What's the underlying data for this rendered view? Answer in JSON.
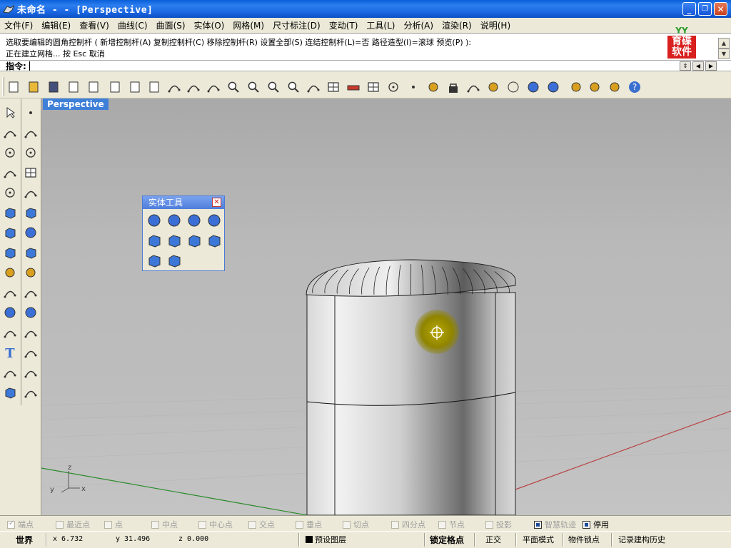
{
  "window": {
    "title": "未命名 -  - [Perspective]",
    "minimize": "_",
    "restore": "❐",
    "close": "✕"
  },
  "menu": [
    "文件(F)",
    "编辑(E)",
    "查看(V)",
    "曲线(C)",
    "曲面(S)",
    "实体(O)",
    "网格(M)",
    "尺寸标注(D)",
    "变动(T)",
    "工具(L)",
    "分析(A)",
    "渲染(R)",
    "说明(H)"
  ],
  "command": {
    "history_line1": "选取要编辑的圆角控制杆 ( 新增控制杆(A)  复制控制杆(C)  移除控制杆(R)  设置全部(S)  连结控制杆(L)=否  路径造型(I)=滚球  预览(P) ):",
    "history_line2": "正在建立网格... 按 Esc 取消",
    "prompt_label": "指令:",
    "prompt_value": ""
  },
  "logo": {
    "top": "YY",
    "line1": "育碟",
    "line2": "软件",
    "color": "#d8201e"
  },
  "toolbar_icons": [
    "new-file-icon",
    "open-folder-icon",
    "save-icon",
    "print-icon",
    "import-icon",
    "cut-icon",
    "copy-icon",
    "paste-icon",
    "undo-icon",
    "pan-hand-icon",
    "rotate-view-icon",
    "zoom-icon",
    "zoom-window-icon",
    "zoom-extents-icon",
    "zoom-selected-icon",
    "undo-view-icon",
    "four-viewports-icon",
    "car-icon",
    "grid-plane-icon",
    "osnap-icon",
    "point-object-icon",
    "light-bulb-icon",
    "lock-icon",
    "layer-icon",
    "color-wheel-icon",
    "wireframe-sphere-icon",
    "shaded-sphere-icon",
    "render-sphere-icon",
    "flag-icon",
    "gear-icon",
    "options-icon",
    "help-icon"
  ],
  "left_tools": [
    "select-arrow-icon",
    "point-icon",
    "polyline-icon",
    "curve-icon",
    "circle-icon",
    "ellipse-icon",
    "arc-icon",
    "rectangle-icon",
    "polygon-icon",
    "freeform-curve-icon",
    "surface-icon",
    "patch-icon",
    "box-icon",
    "sphere-icon",
    "cylinder-icon",
    "mesh-icon",
    "explode-icon",
    "lightning-icon",
    "trim-icon",
    "split-icon",
    "boolean-union-icon",
    "boolean-split-icon",
    "fillet-icon",
    "extend-icon",
    "text-icon",
    "scale-icon",
    "array-icon",
    "dimension-icon",
    "solid-tools-icon",
    "ruler-icon"
  ],
  "viewport": {
    "title": "Perspective",
    "axes": {
      "x": "x",
      "y": "y",
      "z": "z"
    }
  },
  "solid_panel": {
    "title": "实体工具",
    "close": "✕",
    "icons": [
      "boolean-union-icon",
      "boolean-difference-icon",
      "boolean-intersection-icon",
      "boolean-split-icon",
      "cap-holes-icon",
      "extract-surface-icon",
      "extrude-face-icon",
      "move-face-icon",
      "solid-box-icon",
      "solid-edit-icon"
    ]
  },
  "osnaps": [
    {
      "label": "端点",
      "checked": true,
      "enabled": false
    },
    {
      "label": "最近点",
      "checked": false,
      "enabled": false
    },
    {
      "label": "点",
      "checked": false,
      "enabled": false
    },
    {
      "label": "中点",
      "checked": false,
      "enabled": false
    },
    {
      "label": "中心点",
      "checked": false,
      "enabled": false
    },
    {
      "label": "交点",
      "checked": false,
      "enabled": false
    },
    {
      "label": "垂点",
      "checked": false,
      "enabled": false
    },
    {
      "label": "切点",
      "checked": false,
      "enabled": false
    },
    {
      "label": "四分点",
      "checked": false,
      "enabled": false
    },
    {
      "label": "节点",
      "checked": false,
      "enabled": false
    },
    {
      "label": "投影",
      "checked": false,
      "enabled": false
    },
    {
      "label": "智慧轨迹",
      "checked": true,
      "enabled": false
    },
    {
      "label": "停用",
      "checked": true,
      "enabled": true
    }
  ],
  "status": {
    "cplane": "世界",
    "x": "x 6.732",
    "y": "y 31.496",
    "z": "z 0.000",
    "layer": "预设图层",
    "snap": "锁定格点",
    "ortho": "正交",
    "planar": "平面模式",
    "osnap": "物件锁点",
    "history": "记录建构历史"
  }
}
